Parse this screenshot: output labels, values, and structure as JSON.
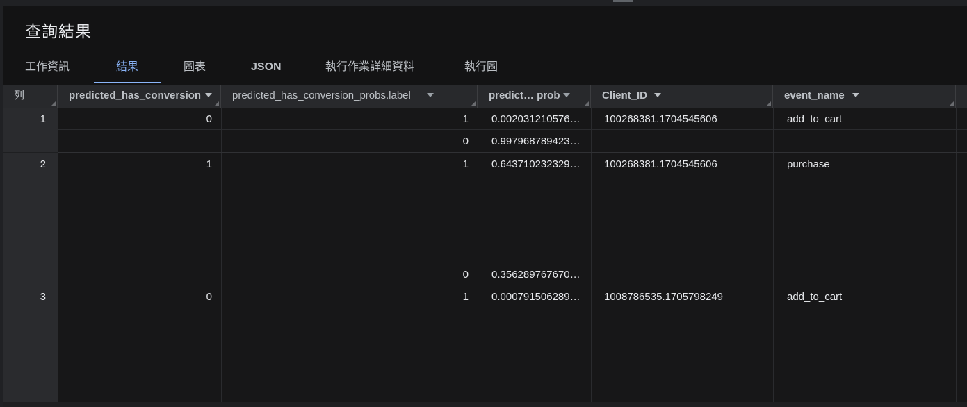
{
  "title": "查詢結果",
  "tabs": [
    {
      "label": "工作資訊"
    },
    {
      "label": "結果"
    },
    {
      "label": "圖表"
    },
    {
      "label": "JSON"
    },
    {
      "label": "執行作業詳細資料"
    },
    {
      "label": "執行圖"
    }
  ],
  "active_tab": "結果",
  "table": {
    "row_header": "列",
    "columns": [
      {
        "label": "predicted_has_conversion"
      },
      {
        "label": "predicted_has_conversion_probs.label"
      },
      {
        "label": "predict… prob"
      },
      {
        "label": "Client_ID"
      },
      {
        "label": "event_name"
      }
    ],
    "rows": [
      {
        "num": "1",
        "predicted_has_conversion": "0",
        "probs": [
          {
            "label": "1",
            "prob": "0.002031210576…"
          },
          {
            "label": "0",
            "prob": "0.997968789423…"
          }
        ],
        "client_id": "100268381.1704545606",
        "event_name": "add_to_cart"
      },
      {
        "num": "2",
        "predicted_has_conversion": "1",
        "probs": [
          {
            "label": "1",
            "prob": "0.643710232329…"
          },
          {
            "label": "0",
            "prob": "0.356289767670…"
          }
        ],
        "client_id": "100268381.1704545606",
        "event_name": "purchase"
      },
      {
        "num": "3",
        "predicted_has_conversion": "0",
        "probs": [
          {
            "label": "1",
            "prob": "0.000791506289…"
          }
        ],
        "client_id": "1008786535.1705798249",
        "event_name": "add_to_cart"
      }
    ]
  },
  "colors": {
    "accent": "#8ab4f8",
    "background": "#131314",
    "header_bg": "#28292c",
    "text": "#e8eaed"
  }
}
